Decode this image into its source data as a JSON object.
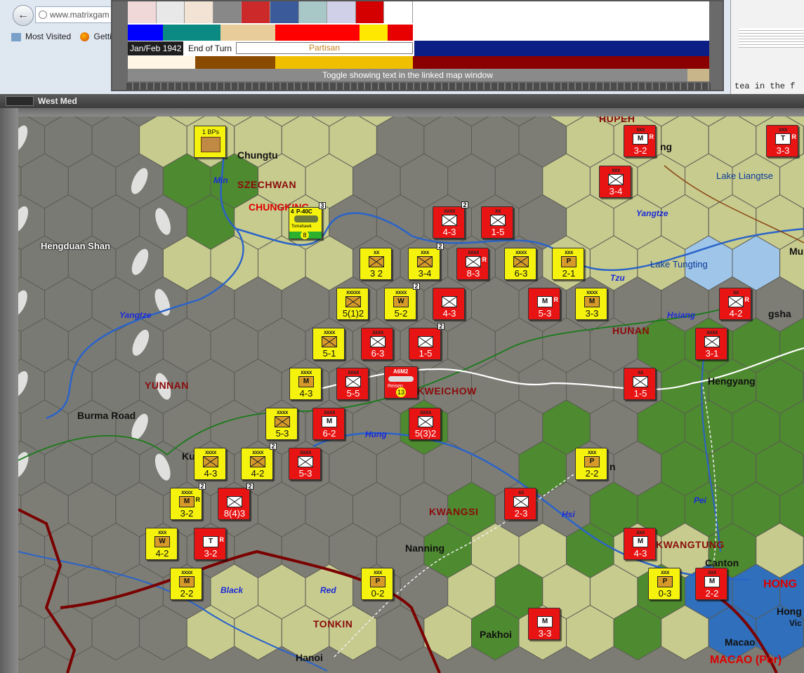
{
  "browser": {
    "back_glyph": "←",
    "url_text": "www.matrixgam",
    "bookmarks": [
      "Most Visited",
      "Getti"
    ],
    "right_text": "tea in the f"
  },
  "popup": {
    "flags": [
      {
        "color": "#f0d8d8"
      },
      {
        "color": "#e8e8e8"
      },
      {
        "color": "#f2e3d4"
      },
      {
        "color": "#888888"
      },
      {
        "color": "#cc2a2a"
      },
      {
        "color": "#3a5a9a"
      },
      {
        "color": "#a8c8c8"
      },
      {
        "color": "#d0d0e8"
      },
      {
        "color": "#d40000"
      },
      {
        "color": "#ffffff"
      }
    ],
    "colors": [
      "#0000ff",
      "#0a8a82",
      "#e8cc9a",
      "#ff0000",
      "#ffe800",
      "#e80000",
      "#ffffff"
    ],
    "date": "Jan/Feb 1942",
    "end_of_turn": "End of Turn",
    "status_field": "Partisan",
    "bands": [
      "#fff6e6",
      "#8a4a00",
      "#f0c000",
      "#8a0000"
    ],
    "toggle_text": "Toggle showing text in the linked map window"
  },
  "map_window": {
    "title": "West Med"
  },
  "map": {
    "regions": [
      "SZECHWAN",
      "YUNNAN",
      "KWEICHOW",
      "KWANGSI",
      "HUNAN",
      "TONKIN",
      "KWANGTUNG",
      "HUPEH"
    ],
    "rivers": [
      "Min",
      "Yangtze",
      "Yangtze",
      "Tzu",
      "Hsiang",
      "Hung",
      "Hsi",
      "Pei",
      "Black",
      "Red"
    ],
    "places": [
      "Hengduan Shan",
      "Burma Road",
      "Chungtu",
      "CHUNGKING",
      "Lake Tungting",
      "Lake Liangtse",
      "Hengyang",
      "Nanning",
      "Pakhoi",
      "Hanoi",
      "Canton",
      "Macao",
      "MACAO (Por)",
      "HONG",
      "Hong",
      "Vic",
      "Mu",
      "Ku",
      "gsha",
      "ng",
      "an",
      "n"
    ],
    "bp_label": "1 BPs",
    "air_units": [
      {
        "label": "P-40C",
        "name": "Tomahawk",
        "count": "4",
        "stack": "3",
        "num": "8"
      },
      {
        "label": "A6M2",
        "name": "Reisen",
        "num": "13"
      }
    ],
    "units": [
      {
        "side": "jp",
        "size": "xxx",
        "str": "3-2",
        "code": "M",
        "tag": "R"
      },
      {
        "side": "jp",
        "size": "xxx",
        "str": "3-3",
        "code": "T",
        "tag": "R"
      },
      {
        "side": "jp",
        "size": "xxx",
        "str": "3-4",
        "code": ""
      },
      {
        "side": "jp",
        "size": "xxxx",
        "str": "4-3",
        "code": "",
        "stack": "2"
      },
      {
        "side": "jp",
        "size": "xx",
        "str": "1-5",
        "code": ""
      },
      {
        "side": "ch",
        "size": "xx",
        "str": "3 2",
        "code": ""
      },
      {
        "side": "ch",
        "size": "xxx",
        "str": "3-4",
        "code": "",
        "stack": "2"
      },
      {
        "side": "jp",
        "size": "xxxx",
        "str": "8-3",
        "code": "",
        "tag": "R"
      },
      {
        "side": "ch",
        "size": "xxxx",
        "str": "6-3",
        "code": ""
      },
      {
        "side": "ch",
        "size": "xxx",
        "str": "2-1",
        "code": "P"
      },
      {
        "side": "ch",
        "size": "xxxxx",
        "str": "5(1)2",
        "code": ""
      },
      {
        "side": "ch",
        "size": "xxxx",
        "str": "5-2",
        "code": "W",
        "stack": "2"
      },
      {
        "side": "jp",
        "size": "",
        "str": "4-3",
        "code": ""
      },
      {
        "side": "jp",
        "size": "",
        "str": "5-3",
        "code": "M",
        "tag": "R"
      },
      {
        "side": "ch",
        "size": "xxxx",
        "str": "3-3",
        "code": "M"
      },
      {
        "side": "ch",
        "size": "xxxx",
        "str": "5-1",
        "code": ""
      },
      {
        "side": "jp",
        "size": "xxxx",
        "str": "6-3",
        "code": ""
      },
      {
        "side": "jp",
        "size": "",
        "str": "1-5",
        "code": "",
        "stack": "2"
      },
      {
        "side": "jp",
        "size": "xx",
        "str": "4-2",
        "code": "",
        "tag": "R"
      },
      {
        "side": "jp",
        "size": "xxxx",
        "str": "3-1",
        "code": ""
      },
      {
        "side": "ch",
        "size": "xxxx",
        "str": "4-3",
        "code": "M"
      },
      {
        "side": "jp",
        "size": "xxxx",
        "str": "5-5",
        "code": ""
      },
      {
        "side": "jp",
        "size": "xx",
        "str": "1-5",
        "code": ""
      },
      {
        "side": "ch",
        "size": "xxxx",
        "str": "5-3",
        "code": ""
      },
      {
        "side": "jp",
        "size": "xxxx",
        "str": "6-2",
        "code": "M"
      },
      {
        "side": "jp",
        "size": "xxxx",
        "str": "5(3)2",
        "code": ""
      },
      {
        "side": "ch",
        "size": "xxxx",
        "str": "4-3",
        "code": ""
      },
      {
        "side": "ch",
        "size": "xxxx",
        "str": "4-2",
        "code": "",
        "stack": "2"
      },
      {
        "side": "jp",
        "size": "xxxx",
        "str": "5-3",
        "code": ""
      },
      {
        "side": "ch",
        "size": "xxx",
        "str": "2-2",
        "code": "P"
      },
      {
        "side": "ch",
        "size": "xxxx",
        "str": "3-2",
        "code": "M",
        "stack": "2",
        "tag": "R"
      },
      {
        "side": "jp",
        "size": "",
        "str": "8(4)3",
        "code": "",
        "stack": "2"
      },
      {
        "side": "jp",
        "size": "xx",
        "str": "2-3",
        "code": ""
      },
      {
        "side": "ch",
        "size": "xxx",
        "str": "4-2",
        "code": "W"
      },
      {
        "side": "jp",
        "size": "",
        "str": "3-2",
        "code": "T",
        "tag": "R"
      },
      {
        "side": "jp",
        "size": "xxx",
        "str": "4-3",
        "code": "M"
      },
      {
        "side": "ch",
        "size": "xxxx",
        "str": "2-2",
        "code": "M"
      },
      {
        "side": "ch",
        "size": "xxx",
        "str": "0-2",
        "code": "P"
      },
      {
        "side": "ch",
        "size": "xxx",
        "str": "0-3",
        "code": "P"
      },
      {
        "side": "jp",
        "size": "xxx",
        "str": "2-2",
        "code": "M"
      },
      {
        "side": "jp",
        "size": "",
        "str": "3-3",
        "code": "M"
      }
    ]
  }
}
